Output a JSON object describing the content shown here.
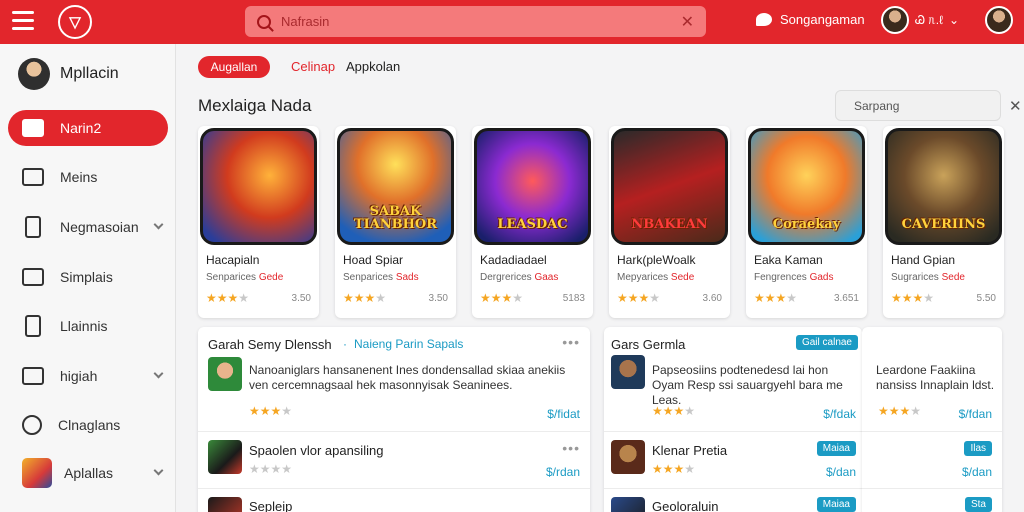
{
  "topbar": {
    "search_placeholder": "Nafrasin",
    "message_label": "Songangaman",
    "user_label": "Ꮚ ᥰ.ℓ"
  },
  "sidebar": {
    "user_name": "Mpllacin",
    "items": [
      {
        "label": "Narin2"
      },
      {
        "label": "Meins"
      },
      {
        "label": "Negmasoian"
      },
      {
        "label": "Simplais"
      },
      {
        "label": "Llainnis"
      },
      {
        "label": "higiah"
      },
      {
        "label": "Clnaglans"
      },
      {
        "label": "Aplallas"
      }
    ]
  },
  "filters": {
    "active": "Augallan",
    "link1": "Celinap",
    "link2": "Appkolan"
  },
  "section": {
    "title": "Mexlaiga Nada",
    "search_placeholder": "Sarpang"
  },
  "cards": [
    {
      "art_text": "",
      "name": "Hacapialn",
      "sub": "Senparices",
      "tag": "Gede",
      "rating": 3,
      "value": "3.50"
    },
    {
      "art_text": "SABAK TIANBHOR",
      "name": "Hoad Spiar",
      "sub": "Senparices",
      "tag": "Sads",
      "rating": 3,
      "value": "3.50"
    },
    {
      "art_text": "LEASDAC",
      "name": "Kadadiadael",
      "sub": "Dergrerices",
      "tag": "Gaas",
      "rating": 3,
      "value": "5183"
    },
    {
      "art_text": "NBAKEAN",
      "name": "Hark(pleWoalk",
      "sub": "Mepyarices",
      "tag": "Sede",
      "rating": 3,
      "value": "3.60"
    },
    {
      "art_text": "Coraekay",
      "name": "Eaka Kaman",
      "sub": "Fengrences",
      "tag": "Gads",
      "rating": 3,
      "value": "3.651"
    },
    {
      "art_text": "CAVERIINS",
      "name": "Hand Gpian",
      "sub": "Sugrarices",
      "tag": "Sede",
      "rating": 3,
      "value": "5.50"
    }
  ],
  "colors": {
    "brand": "#e2262c",
    "accent": "#1b9bc4",
    "star": "#f5a623"
  },
  "panel_left": {
    "title": "Garah Semy Dlenssh",
    "separator": "·",
    "link": "Naieng Parin Sapals",
    "rows": [
      {
        "title": "",
        "desc": "Nanoaniglars hansanenent Ines dondensallad skiaa anekiis ven cercemnagsaal hek masonnyisak Seaninees.",
        "price": "$/fidat",
        "rating": 3
      },
      {
        "title": "Spaolen vlor apansiling",
        "desc": "",
        "price": "$/rdan",
        "rating": 0
      },
      {
        "title": "Sepleip",
        "desc": "",
        "price": "",
        "rating": 0
      }
    ]
  },
  "panel_right": {
    "title": "Gars Germla",
    "badge": "Gail calnae",
    "rows": [
      {
        "title": "",
        "desc": "Papseosiins podtenedesd lai hon Oyam Resp ssi sauargyehl bara me Leas.",
        "price": "$/fdak",
        "rating": 3,
        "badge": ""
      },
      {
        "title": "Klenar Pretia",
        "desc": "",
        "price": "$/dan",
        "rating": 3,
        "badge": "Maiaa"
      },
      {
        "title": "Geoloraluin",
        "desc": "",
        "price": "",
        "rating": 0,
        "badge": "Maiaa"
      }
    ]
  },
  "panel_far": {
    "rows": [
      {
        "desc": "Leardone Faakiina nansiss Innaplain ldst.",
        "price": "$/fdan",
        "rating": 3,
        "badge": ""
      },
      {
        "desc": "",
        "price": "$/dan",
        "rating": 0,
        "badge": "Ilas"
      },
      {
        "desc": "",
        "price": "",
        "rating": 0,
        "badge": "Sta"
      }
    ]
  }
}
